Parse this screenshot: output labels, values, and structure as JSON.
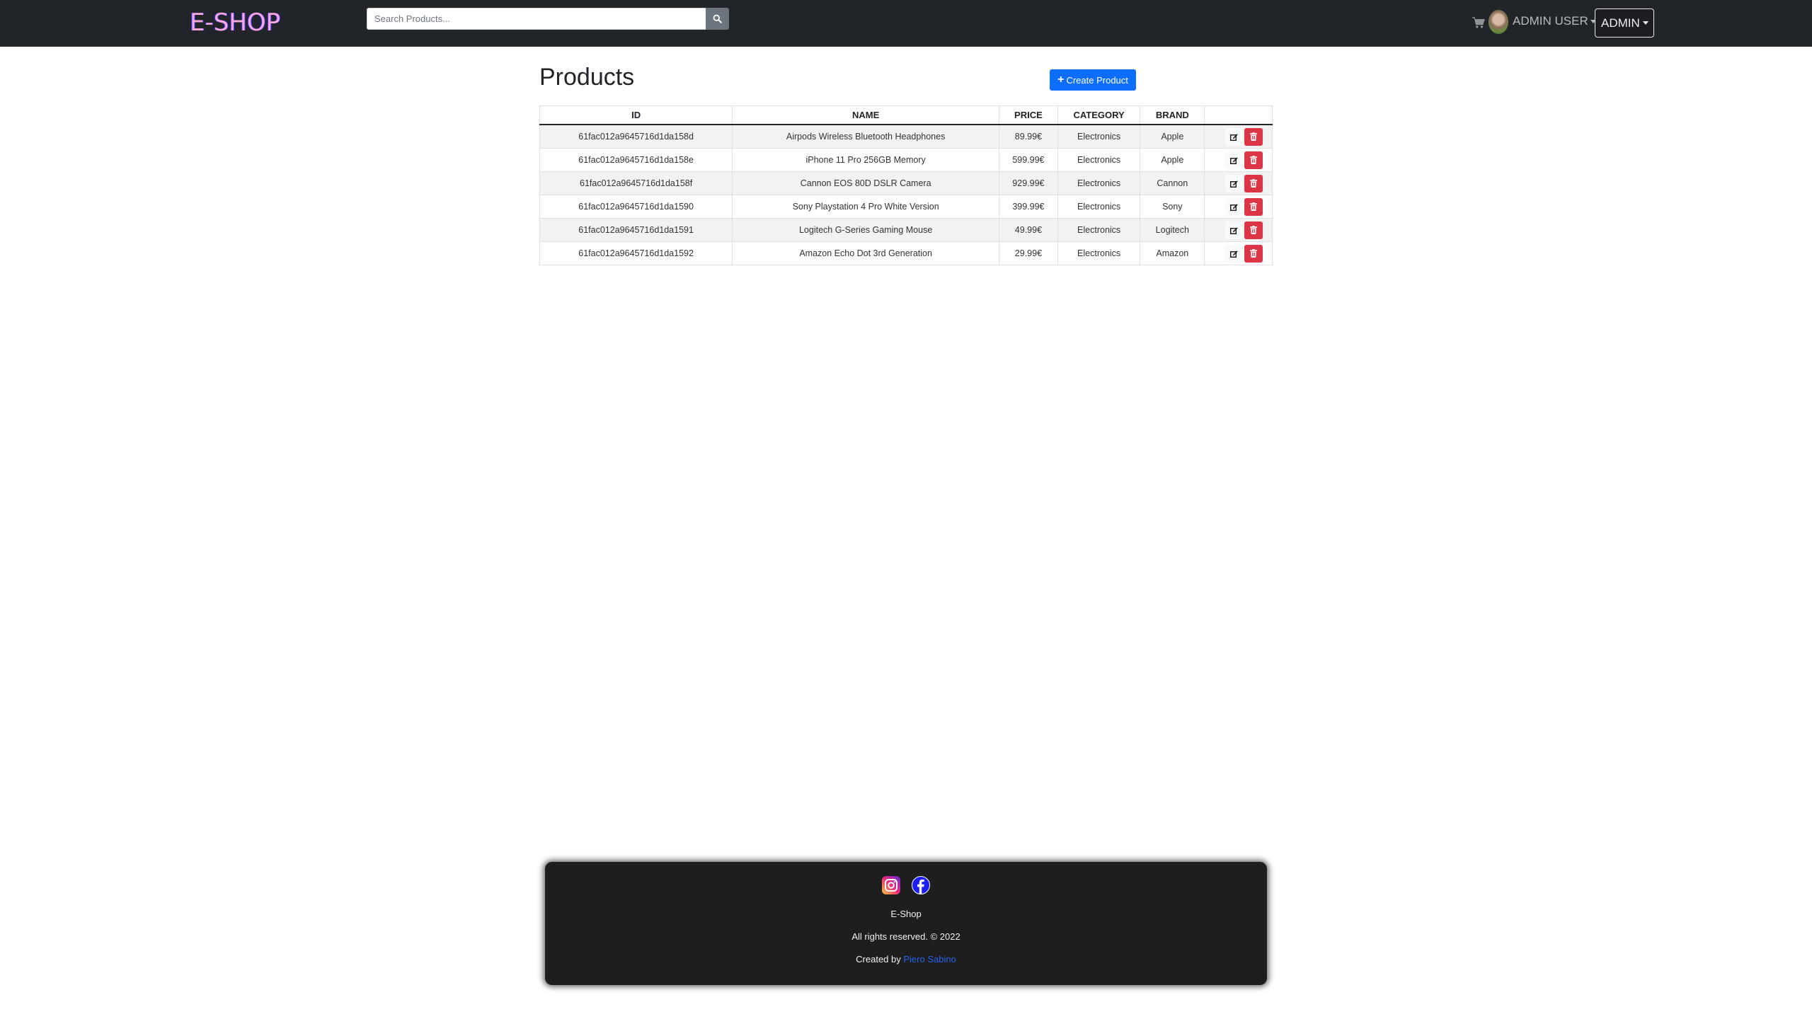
{
  "navbar": {
    "logo": "E-SHOP",
    "search_placeholder": "Search Products...",
    "search_value": "",
    "user_menu_label": "ADMIN USER",
    "admin_menu_label": "ADMIN",
    "icons": {
      "search": "search-icon",
      "cart": "cart-icon",
      "avatar": "user-avatar"
    }
  },
  "main": {
    "title": "Products",
    "create_button_label": "Create Product",
    "table": {
      "columns": [
        "ID",
        "NAME",
        "PRICE",
        "CATEGORY",
        "BRAND",
        ""
      ],
      "rows": [
        {
          "id": "61fac012a9645716d1da158d",
          "name": "Airpods Wireless Bluetooth Headphones",
          "price": "89.99€",
          "category": "Electronics",
          "brand": "Apple"
        },
        {
          "id": "61fac012a9645716d1da158e",
          "name": "iPhone 11 Pro 256GB Memory",
          "price": "599.99€",
          "category": "Electronics",
          "brand": "Apple"
        },
        {
          "id": "61fac012a9645716d1da158f",
          "name": "Cannon EOS 80D DSLR Camera",
          "price": "929.99€",
          "category": "Electronics",
          "brand": "Cannon"
        },
        {
          "id": "61fac012a9645716d1da1590",
          "name": "Sony Playstation 4 Pro White Version",
          "price": "399.99€",
          "category": "Electronics",
          "brand": "Sony"
        },
        {
          "id": "61fac012a9645716d1da1591",
          "name": "Logitech G-Series Gaming Mouse",
          "price": "49.99€",
          "category": "Electronics",
          "brand": "Logitech"
        },
        {
          "id": "61fac012a9645716d1da1592",
          "name": "Amazon Echo Dot 3rd Generation",
          "price": "29.99€",
          "category": "Electronics",
          "brand": "Amazon"
        }
      ],
      "row_actions": [
        "edit-icon",
        "trash-icon"
      ]
    }
  },
  "footer": {
    "social": [
      "instagram-icon",
      "facebook-icon"
    ],
    "brand": "E-Shop",
    "rights": "All rights reserved. © 2022",
    "created_by_prefix": "Created by",
    "author": "Piero Sabino"
  },
  "colors": {
    "navbar_bg": "#212529",
    "primary": "#0d6efd",
    "danger": "#dc3545",
    "footer_bg": "#1e1e1e",
    "link": "#2563eb"
  }
}
